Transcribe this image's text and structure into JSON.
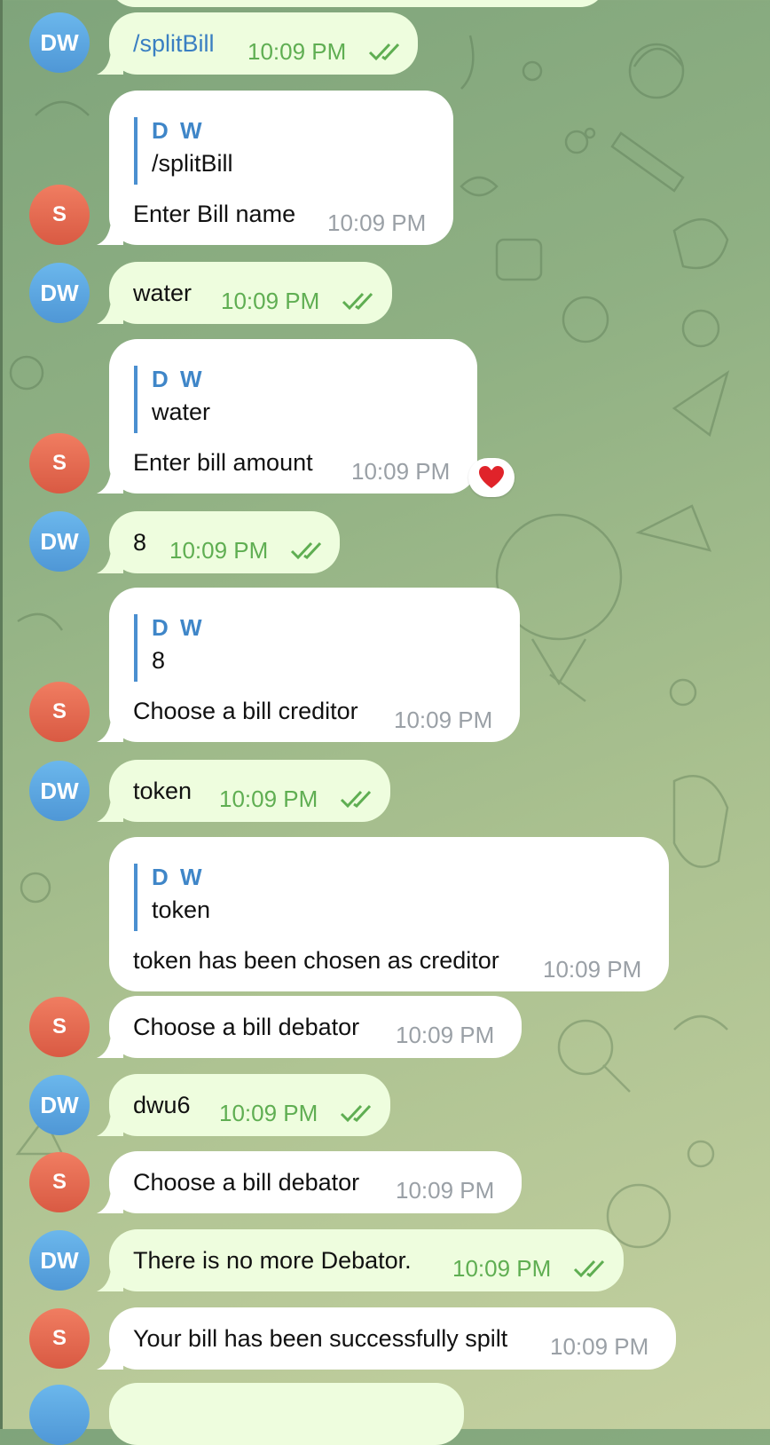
{
  "avatars": {
    "user": "DW",
    "bot": "S"
  },
  "icons": {
    "read_checks": "double-check-icon",
    "reaction": "heart-emoji"
  },
  "messages": [
    {
      "from": "user",
      "text": "/splitBill",
      "time": "10:09 PM"
    },
    {
      "from": "bot",
      "reply_name": "D W",
      "reply_text": "/splitBill",
      "text": "Enter Bill name",
      "time": "10:09 PM"
    },
    {
      "from": "user",
      "text": "water",
      "time": "10:09 PM"
    },
    {
      "from": "bot",
      "reply_name": "D W",
      "reply_text": "water",
      "text": "Enter bill amount",
      "time": "10:09 PM",
      "reaction": "❤️"
    },
    {
      "from": "user",
      "text": "8",
      "time": "10:09 PM"
    },
    {
      "from": "bot",
      "reply_name": "D W",
      "reply_text": "8",
      "text": "Choose a bill creditor",
      "time": "10:09 PM"
    },
    {
      "from": "user",
      "text": "token",
      "time": "10:09 PM"
    },
    {
      "from": "bot",
      "reply_name": "D W",
      "reply_text": "token",
      "text": "token has been chosen as creditor",
      "time": "10:09 PM"
    },
    {
      "from": "bot",
      "text": "Choose a bill debator",
      "time": "10:09 PM"
    },
    {
      "from": "user",
      "text": "dwu6",
      "time": "10:09 PM"
    },
    {
      "from": "bot",
      "text": "Choose a bill debator",
      "time": "10:09 PM"
    },
    {
      "from": "user",
      "text": "There is no more Debator.",
      "time": "10:09 PM"
    },
    {
      "from": "bot",
      "text": "Your bill has been successfully spilt",
      "time": "10:09 PM"
    }
  ],
  "colors": {
    "outgoing_bubble": "#eefdde",
    "incoming_bubble": "#ffffff",
    "accent": "#3f86c8",
    "check": "#5fae52"
  }
}
